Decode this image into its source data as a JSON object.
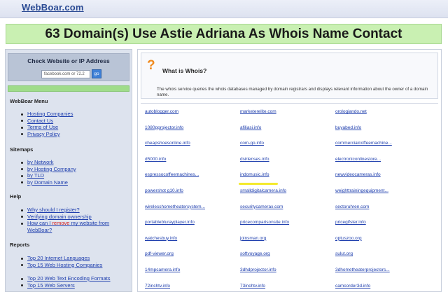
{
  "header": {
    "logo": "WebBoar.com"
  },
  "page_title": "63 Domain(s) Use Astie Adriana As Whois Name Contact",
  "sidebar": {
    "check_title": "Check Website or IP Address",
    "check_input_value": "facebook.com or 72.2",
    "check_button": "go",
    "menu_title": "WebBoar Menu",
    "menu_items": [
      "Hosting Companies",
      "Contact Us",
      "Terms of Use",
      "Privacy Policy"
    ],
    "sitemaps_title": "Sitemaps",
    "sitemaps_items": [
      "by Network",
      "by Hosting Company",
      "by TLD",
      "by Domain Name"
    ],
    "help_title": "Help",
    "help_items": [
      "Why should I register?",
      "Verifying domain ownership"
    ],
    "help_remove_pre": "How can I ",
    "help_remove_red": "remove",
    "help_remove_post": " my website from WebBoar?",
    "reports_title": "Reports",
    "reports_items_a": [
      "Top 20 Internet Languages",
      "Top 15 Web Hosting Companies"
    ],
    "reports_items_b": [
      "Top 20 Web Text Encoding Formats",
      "Top 15 Web Servers"
    ]
  },
  "whois": {
    "heading": "What is Whois?",
    "text": "The whois service queries the whois databases managed by domain registrars and displays relevant information about the owner of a domain name."
  },
  "domains": [
    [
      "autoblogger.com",
      "marketerelite.com",
      "orologiando.net"
    ],
    [
      "1080pprojector.info",
      "afiliasi.info",
      "buyabed.info"
    ],
    [
      "cheapshoesonline.info",
      "com-go.info",
      "commercialcoffeemachine..."
    ],
    [
      "d5000.info",
      "dsirlenses.info",
      "electroniconlinestore..."
    ],
    [
      "espressocoffeemachines...",
      "indomusic.info",
      "newvideocameras.info"
    ],
    [
      "powershot g10.info",
      "smalldigitalcamera.info",
      "weighttrainingequipment..."
    ],
    [
      "wirelesshometheatersystem...",
      "securitycamerax.com",
      "sectoruhren.com"
    ],
    [
      "portableblurayplayer.info",
      "pricecomparisonsite.info",
      "pricegifster.info"
    ],
    [
      "watchesbuy.info",
      "joinsman.org",
      "optuszoo.org"
    ],
    [
      "pdf-viewer.org",
      "softvoyage.org",
      "sulut.org"
    ],
    [
      "14mpcamera.info",
      "3dhdprojector.info",
      "3dhometheaterprojectors..."
    ],
    [
      "72inchtv.info",
      "73inchtv.info",
      "camcorder3d.info"
    ]
  ],
  "colors": {
    "title_bg": "#c9f0b2",
    "link": "#1f3fae",
    "highlight": "#f4ea2e",
    "question": "#f08a1d"
  }
}
